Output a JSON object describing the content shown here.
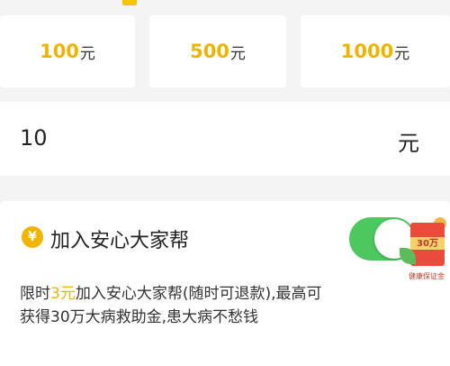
{
  "amount_options": [
    {
      "value": "100",
      "unit": "元"
    },
    {
      "value": "500",
      "unit": "元"
    },
    {
      "value": "1000",
      "unit": "元"
    }
  ],
  "custom_amount": {
    "value": "10",
    "unit": "元"
  },
  "plan": {
    "icon": "yen-icon",
    "icon_glyph": "¥",
    "title": "加入安心大家帮",
    "toggle_on": true,
    "desc_prefix": "限时",
    "desc_highlight": "3元",
    "desc_rest": "加入安心大家帮(随时可退款),最高可获得30万大病救助金,患大病不愁钱",
    "badge_amount": "30万",
    "badge_label": "健康保证金"
  },
  "colors": {
    "accent": "#f0b300",
    "toggle": "#4cc85f",
    "background": "#f4f4f4"
  }
}
